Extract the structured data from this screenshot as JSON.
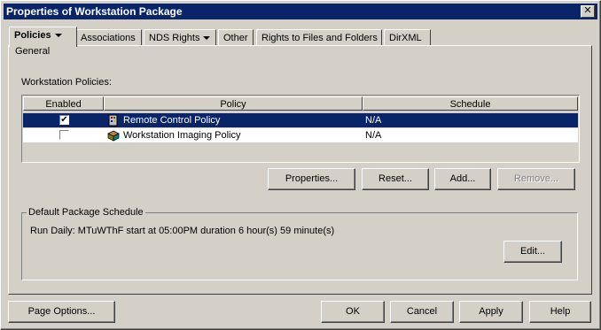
{
  "window": {
    "title": "Properties of Workstation Package"
  },
  "tabs": [
    {
      "label": "Policies",
      "has_dropdown": true,
      "active": true
    },
    {
      "label": "Associations"
    },
    {
      "label": "NDS Rights",
      "has_dropdown": true
    },
    {
      "label": "Other"
    },
    {
      "label": "Rights to Files and Folders"
    },
    {
      "label": "DirXML"
    }
  ],
  "subtab": "General",
  "policies": {
    "label": "Workstation Policies:",
    "columns": [
      "Enabled",
      "Policy",
      "Schedule"
    ],
    "rows": [
      {
        "enabled": true,
        "icon": "remote-control-icon",
        "policy": "Remote Control Policy",
        "schedule": "N/A",
        "selected": true
      },
      {
        "enabled": false,
        "icon": "imaging-icon",
        "policy": "Workstation Imaging Policy",
        "schedule": "N/A",
        "selected": false
      }
    ]
  },
  "buttons": {
    "properties": "Properties...",
    "reset": "Reset...",
    "add": "Add...",
    "remove": "Remove..."
  },
  "default_schedule": {
    "title": "Default Package Schedule",
    "text": "Run Daily: MTuWThF start at 05:00PM duration 6 hour(s) 59 minute(s)",
    "edit": "Edit..."
  },
  "footer": {
    "page_options": "Page Options...",
    "ok": "OK",
    "cancel": "Cancel",
    "apply": "Apply",
    "help": "Help"
  },
  "colors": {
    "titlebar": "#0a246a",
    "selection": "#0a246a",
    "face": "#d4d0c8"
  }
}
